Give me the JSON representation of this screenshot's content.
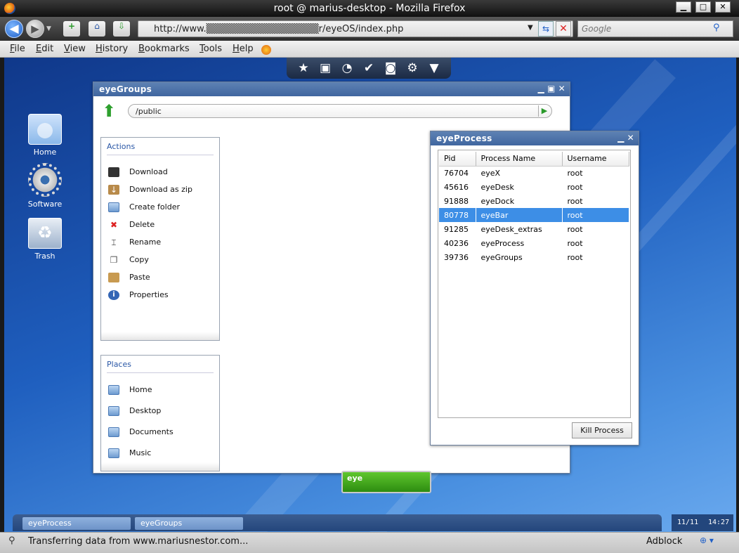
{
  "browser": {
    "window_title": "root @ marius-desktop - Mozilla Firefox",
    "url": "http://www.▒▒▒▒▒▒▒▒▒▒▒▒▒▒▒▒r/eyeOS/index.php",
    "search_placeholder": "Google",
    "menu": [
      "File",
      "Edit",
      "View",
      "History",
      "Bookmarks",
      "Tools",
      "Help"
    ],
    "status_text": "Transferring data from www.mariusnestor.com...",
    "adblock_label": "Adblock"
  },
  "desktop": {
    "icons": [
      {
        "label": "Home"
      },
      {
        "label": "Software"
      },
      {
        "label": "Trash"
      }
    ],
    "dock_icons": [
      "star-icon",
      "briefcase-icon",
      "rss-icon",
      "check-icon",
      "gamepad-icon",
      "gear-icon",
      "inbox-icon"
    ],
    "logo_text": "eye"
  },
  "eyegroups": {
    "title": "eyeGroups",
    "path": "/public",
    "actions": {
      "title": "Actions",
      "items": [
        {
          "label": "Download",
          "icon": "floppy-icon"
        },
        {
          "label": "Download as zip",
          "icon": "archive-icon"
        },
        {
          "label": "Create folder",
          "icon": "folder-icon"
        },
        {
          "label": "Delete",
          "icon": "delete-x-icon"
        },
        {
          "label": "Rename",
          "icon": "rename-cursor-icon"
        },
        {
          "label": "Copy",
          "icon": "copy-icon"
        },
        {
          "label": "Paste",
          "icon": "clipboard-icon"
        },
        {
          "label": "Properties",
          "icon": "info-icon"
        }
      ]
    },
    "places": {
      "title": "Places",
      "items": [
        {
          "label": "Home",
          "icon": "folder-icon"
        },
        {
          "label": "Desktop",
          "icon": "folder-icon"
        },
        {
          "label": "Documents",
          "icon": "folder-icon"
        },
        {
          "label": "Music",
          "icon": "folder-icon"
        }
      ]
    }
  },
  "eyeprocess": {
    "title": "eyeProcess",
    "columns": [
      "Pid",
      "Process Name",
      "Username"
    ],
    "rows": [
      [
        "76704",
        "eyeX",
        "root"
      ],
      [
        "45616",
        "eyeDesk",
        "root"
      ],
      [
        "91888",
        "eyeDock",
        "root"
      ],
      [
        "80778",
        "eyeBar",
        "root"
      ],
      [
        "91285",
        "eyeDesk_extras",
        "root"
      ],
      [
        "40236",
        "eyeProcess",
        "root"
      ],
      [
        "39736",
        "eyeGroups",
        "root"
      ]
    ],
    "selected_row": 3,
    "kill_label": "Kill Process"
  },
  "taskbar": {
    "tasks": [
      "eyeProcess",
      "eyeGroups"
    ],
    "date": "11/11",
    "time": "14:27"
  }
}
